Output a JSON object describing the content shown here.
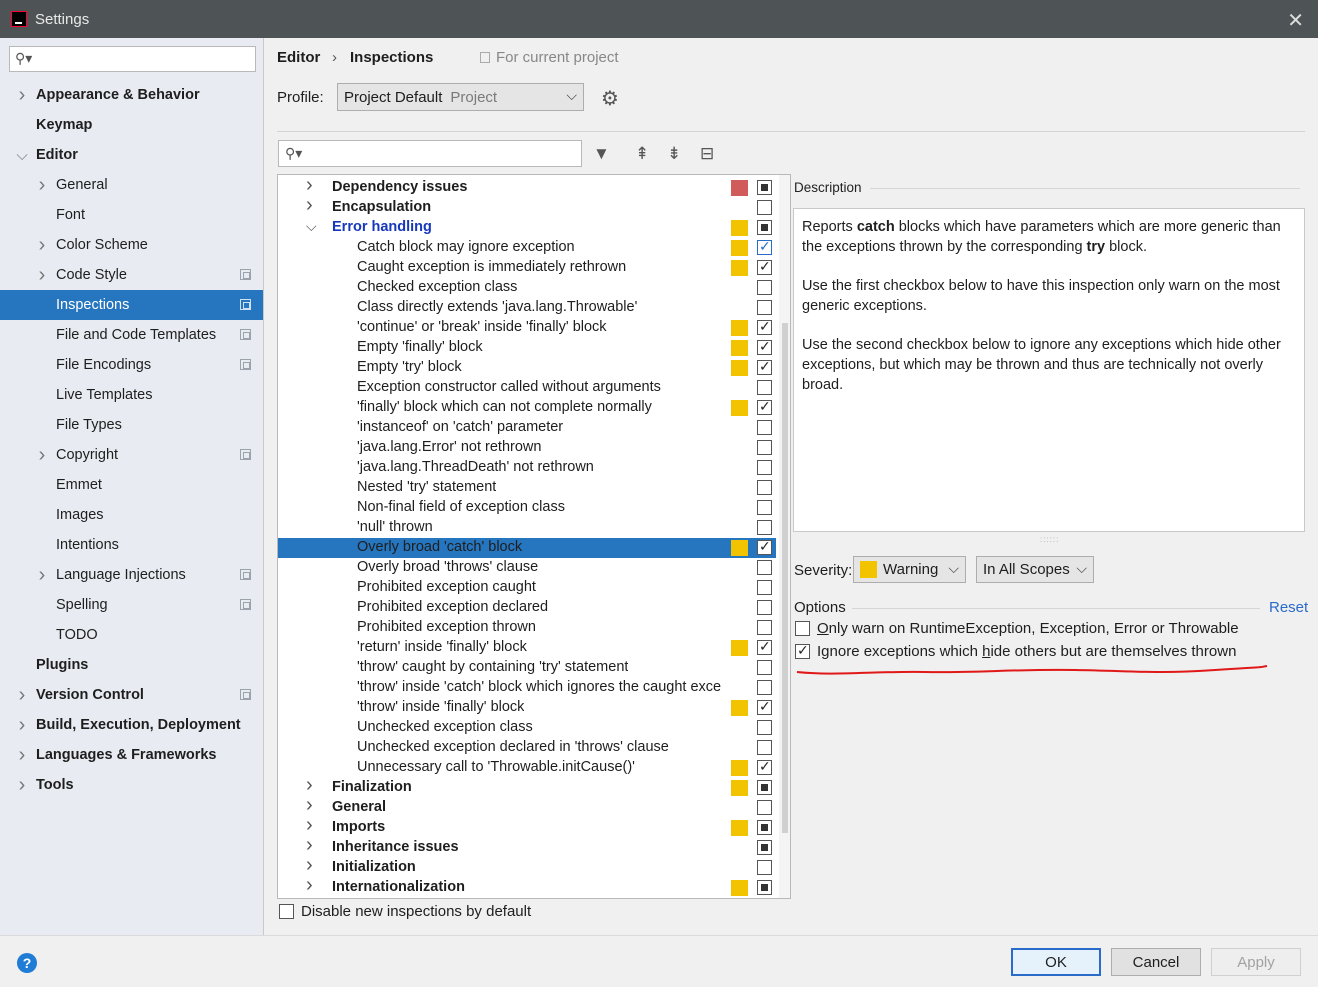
{
  "window": {
    "title": "Settings"
  },
  "nav": {
    "items": [
      {
        "label": "Appearance & Behavior",
        "bold": true,
        "chevron": ">",
        "indent": 0,
        "copy": false
      },
      {
        "label": "Keymap",
        "bold": true,
        "chevron": "",
        "indent": 0,
        "copy": false
      },
      {
        "label": "Editor",
        "bold": true,
        "chevron": "v",
        "indent": 0,
        "copy": false
      },
      {
        "label": "General",
        "bold": false,
        "chevron": ">",
        "indent": 1,
        "copy": false
      },
      {
        "label": "Font",
        "bold": false,
        "chevron": "",
        "indent": 1,
        "copy": false
      },
      {
        "label": "Color Scheme",
        "bold": false,
        "chevron": ">",
        "indent": 1,
        "copy": false
      },
      {
        "label": "Code Style",
        "bold": false,
        "chevron": ">",
        "indent": 1,
        "copy": true
      },
      {
        "label": "Inspections",
        "bold": false,
        "chevron": "",
        "indent": 1,
        "copy": true,
        "selected": true
      },
      {
        "label": "File and Code Templates",
        "bold": false,
        "chevron": "",
        "indent": 1,
        "copy": true
      },
      {
        "label": "File Encodings",
        "bold": false,
        "chevron": "",
        "indent": 1,
        "copy": true
      },
      {
        "label": "Live Templates",
        "bold": false,
        "chevron": "",
        "indent": 1,
        "copy": false
      },
      {
        "label": "File Types",
        "bold": false,
        "chevron": "",
        "indent": 1,
        "copy": false
      },
      {
        "label": "Copyright",
        "bold": false,
        "chevron": ">",
        "indent": 1,
        "copy": true
      },
      {
        "label": "Emmet",
        "bold": false,
        "chevron": "",
        "indent": 1,
        "copy": false
      },
      {
        "label": "Images",
        "bold": false,
        "chevron": "",
        "indent": 1,
        "copy": false
      },
      {
        "label": "Intentions",
        "bold": false,
        "chevron": "",
        "indent": 1,
        "copy": false
      },
      {
        "label": "Language Injections",
        "bold": false,
        "chevron": ">",
        "indent": 1,
        "copy": true
      },
      {
        "label": "Spelling",
        "bold": false,
        "chevron": "",
        "indent": 1,
        "copy": true
      },
      {
        "label": "TODO",
        "bold": false,
        "chevron": "",
        "indent": 1,
        "copy": false
      },
      {
        "label": "Plugins",
        "bold": true,
        "chevron": "",
        "indent": 0,
        "copy": false
      },
      {
        "label": "Version Control",
        "bold": true,
        "chevron": ">",
        "indent": 0,
        "copy": true
      },
      {
        "label": "Build, Execution, Deployment",
        "bold": true,
        "chevron": ">",
        "indent": 0,
        "copy": false
      },
      {
        "label": "Languages & Frameworks",
        "bold": true,
        "chevron": ">",
        "indent": 0,
        "copy": false
      },
      {
        "label": "Tools",
        "bold": true,
        "chevron": ">",
        "indent": 0,
        "copy": false
      }
    ]
  },
  "breadcrumb": {
    "editor": "Editor",
    "sep": "›",
    "inspections": "Inspections",
    "scope": "For current project"
  },
  "profile": {
    "label": "Profile:",
    "value": "Project Default",
    "sub": "Project"
  },
  "tree": {
    "rows": [
      {
        "type": "group",
        "label": "Dependency issues",
        "chevron": ">",
        "sev": "red",
        "check": "partial"
      },
      {
        "type": "group",
        "label": "Encapsulation",
        "chevron": ">",
        "sev": "",
        "check": "none"
      },
      {
        "type": "group",
        "label": "Error handling",
        "chevron": "v",
        "sev": "yellow",
        "check": "partial",
        "blue": true
      },
      {
        "type": "item",
        "label": "Catch block may ignore exception",
        "sev": "yellow",
        "check": "check-blue"
      },
      {
        "type": "item",
        "label": "Caught exception is immediately rethrown",
        "sev": "yellow",
        "check": "check"
      },
      {
        "type": "item",
        "label": "Checked exception class",
        "sev": "",
        "check": "none"
      },
      {
        "type": "item",
        "label": "Class directly extends 'java.lang.Throwable'",
        "sev": "",
        "check": "none"
      },
      {
        "type": "item",
        "label": "'continue' or 'break' inside 'finally' block",
        "sev": "yellow",
        "check": "check"
      },
      {
        "type": "item",
        "label": "Empty 'finally' block",
        "sev": "yellow",
        "check": "check"
      },
      {
        "type": "item",
        "label": "Empty 'try' block",
        "sev": "yellow",
        "check": "check"
      },
      {
        "type": "item",
        "label": "Exception constructor called without arguments",
        "sev": "",
        "check": "none"
      },
      {
        "type": "item",
        "label": "'finally' block which can not complete normally",
        "sev": "yellow",
        "check": "check"
      },
      {
        "type": "item",
        "label": "'instanceof' on 'catch' parameter",
        "sev": "",
        "check": "none"
      },
      {
        "type": "item",
        "label": "'java.lang.Error' not rethrown",
        "sev": "",
        "check": "none"
      },
      {
        "type": "item",
        "label": "'java.lang.ThreadDeath' not rethrown",
        "sev": "",
        "check": "none"
      },
      {
        "type": "item",
        "label": "Nested 'try' statement",
        "sev": "",
        "check": "none"
      },
      {
        "type": "item",
        "label": "Non-final field of exception class",
        "sev": "",
        "check": "none"
      },
      {
        "type": "item",
        "label": "'null' thrown",
        "sev": "",
        "check": "none"
      },
      {
        "type": "item",
        "label": "Overly broad 'catch' block",
        "sev": "yellow",
        "check": "check",
        "selected": true
      },
      {
        "type": "item",
        "label": "Overly broad 'throws' clause",
        "sev": "",
        "check": "none"
      },
      {
        "type": "item",
        "label": "Prohibited exception caught",
        "sev": "",
        "check": "none"
      },
      {
        "type": "item",
        "label": "Prohibited exception declared",
        "sev": "",
        "check": "none"
      },
      {
        "type": "item",
        "label": "Prohibited exception thrown",
        "sev": "",
        "check": "none"
      },
      {
        "type": "item",
        "label": "'return' inside 'finally' block",
        "sev": "yellow",
        "check": "check"
      },
      {
        "type": "item",
        "label": "'throw' caught by containing 'try' statement",
        "sev": "",
        "check": "none"
      },
      {
        "type": "item",
        "label": "'throw' inside 'catch' block which ignores the caught exce",
        "sev": "",
        "check": "none"
      },
      {
        "type": "item",
        "label": "'throw' inside 'finally' block",
        "sev": "yellow",
        "check": "check"
      },
      {
        "type": "item",
        "label": "Unchecked exception class",
        "sev": "",
        "check": "none"
      },
      {
        "type": "item",
        "label": "Unchecked exception declared in 'throws' clause",
        "sev": "",
        "check": "none"
      },
      {
        "type": "item",
        "label": "Unnecessary call to 'Throwable.initCause()'",
        "sev": "yellow",
        "check": "check"
      },
      {
        "type": "group",
        "label": "Finalization",
        "chevron": ">",
        "sev": "yellow",
        "check": "partial"
      },
      {
        "type": "group",
        "label": "General",
        "chevron": ">",
        "sev": "",
        "check": "none"
      },
      {
        "type": "group",
        "label": "Imports",
        "chevron": ">",
        "sev": "yellow",
        "check": "partial"
      },
      {
        "type": "group",
        "label": "Inheritance issues",
        "chevron": ">",
        "sev": "",
        "check": "partial"
      },
      {
        "type": "group",
        "label": "Initialization",
        "chevron": ">",
        "sev": "",
        "check": "none"
      },
      {
        "type": "group",
        "label": "Internationalization",
        "chevron": ">",
        "sev": "yellow",
        "check": "partial"
      }
    ]
  },
  "disable_new": {
    "label": "Disable new inspections by default",
    "checked": false
  },
  "description": {
    "title": "Description",
    "p1_a": "Reports ",
    "p1_b": "catch",
    "p1_c": " blocks which have parameters which are more generic than the exceptions thrown by the corresponding ",
    "p1_d": "try",
    "p1_e": " block.",
    "p2": "Use the first checkbox below to have this inspection only warn on the most generic exceptions.",
    "p3": "Use the second checkbox below to ignore any exceptions which hide other exceptions, but which may be thrown and thus are technically not overly broad."
  },
  "severity": {
    "label": "Severity:",
    "value": "Warning",
    "color": "#f2c400",
    "scope": "In All Scopes"
  },
  "options": {
    "title": "Options",
    "reset": "Reset",
    "opt1_u": "O",
    "opt1_rest": "nly warn on RuntimeException, Exception, Error or Throwable",
    "opt1_checked": false,
    "opt2_a": "Ignore exceptions which ",
    "opt2_u": "h",
    "opt2_b": "ide others but are themselves thrown",
    "opt2_checked": true
  },
  "buttons": {
    "ok": "OK",
    "cancel": "Cancel",
    "apply": "Apply",
    "help": "?"
  }
}
